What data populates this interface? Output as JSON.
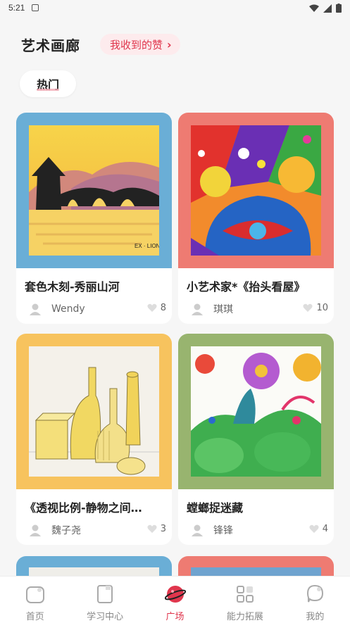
{
  "status_bar": {
    "time": "5:21"
  },
  "header": {
    "title": "艺术画廊",
    "likes_button_label": "我收到的赞"
  },
  "tabs": {
    "hot_label": "热门"
  },
  "cards": [
    {
      "title": "套色木刻-秀丽山河",
      "author": "Wendy",
      "likes": "8",
      "frame_color": "#6aaed6"
    },
    {
      "title": "小艺术家*《抬头看屋》",
      "author": "琪琪",
      "likes": "10",
      "frame_color": "#ee7b72"
    },
    {
      "title": "《透视比例-静物之间…",
      "author": "魏子尧",
      "likes": "3",
      "frame_color": "#f7c35e"
    },
    {
      "title": "螳螂捉迷藏",
      "author": "锋锋",
      "likes": "4",
      "frame_color": "#98b46f"
    }
  ],
  "nav": [
    {
      "label": "首页",
      "icon": "home-icon"
    },
    {
      "label": "学习中心",
      "icon": "study-icon"
    },
    {
      "label": "广场",
      "icon": "planet-icon",
      "active": true
    },
    {
      "label": "能力拓展",
      "icon": "grid-icon"
    },
    {
      "label": "我的",
      "icon": "profile-icon"
    }
  ],
  "colors": {
    "accent": "#e0364d",
    "pill_bg": "#fdebed"
  }
}
